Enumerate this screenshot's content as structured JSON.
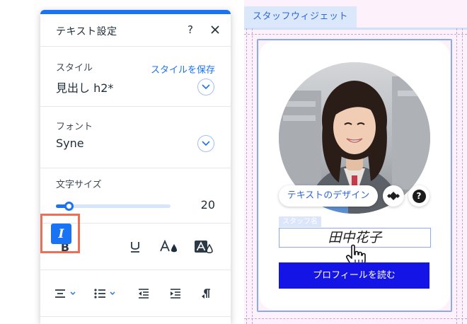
{
  "panel": {
    "title": "テキスト設定",
    "help": "?",
    "style": {
      "label": "スタイル",
      "save_link": "スタイルを保存",
      "value": "見出し h2*"
    },
    "font": {
      "label": "フォント",
      "value": "Syne"
    },
    "text_size": {
      "label": "文字サイズ",
      "value": "20",
      "slider_fraction": 0.11
    },
    "format_buttons": {
      "bold": "B",
      "italic": "I",
      "italic_active": true
    },
    "colors": {
      "accent": "#1a73f2",
      "highlight_outline": "#e8715b"
    }
  },
  "canvas": {
    "widget_tab": "スタッフウィジェット",
    "design_button": "テキストのデザイン",
    "help": "?",
    "staff_tag": "スタッフ名",
    "staff_name": "田中花子",
    "profile_button": "プロフィールを読む",
    "colors": {
      "background": "#fdf1fb",
      "profile_button": "#1414e6",
      "selection": "#8aa9f1"
    }
  }
}
